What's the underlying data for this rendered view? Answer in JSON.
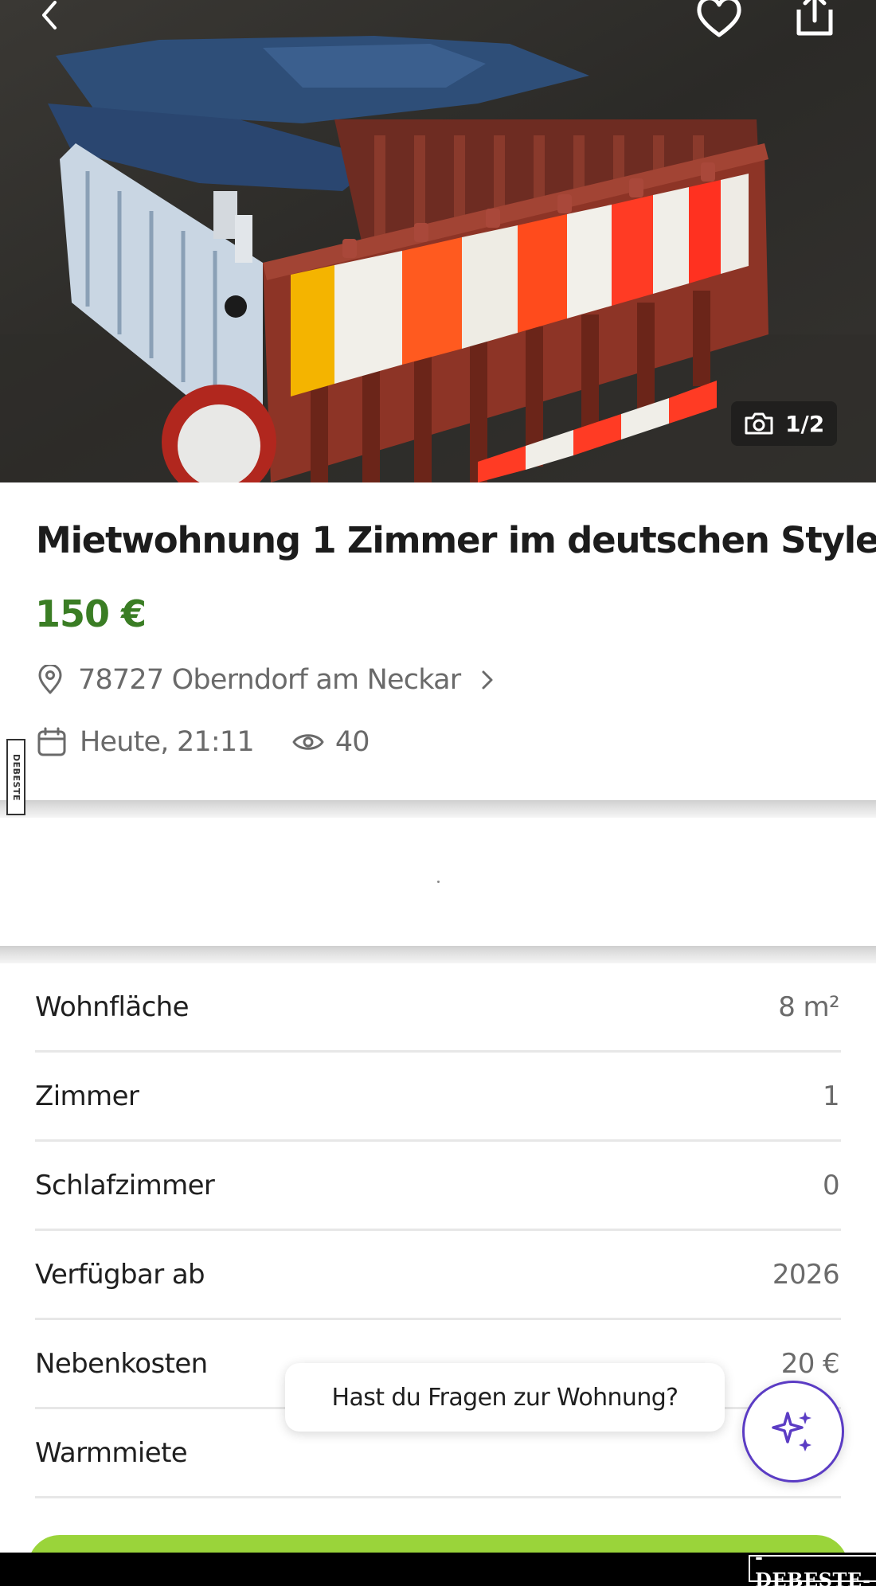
{
  "hero": {
    "photo_counter": "1/2",
    "icons": [
      "back-arrow-icon",
      "heart-icon",
      "share-icon",
      "camera-icon"
    ]
  },
  "listing": {
    "title": "Mietwohnung 1 Zimmer im deutschen Style",
    "price": "150 €",
    "location": "78727 Oberndorf am Neckar",
    "date": "Heute, 21:11",
    "views": "40"
  },
  "attributes": [
    {
      "label": "Wohnfläche",
      "value": "8 m²"
    },
    {
      "label": "Zimmer",
      "value": "1"
    },
    {
      "label": "Schlafzimmer",
      "value": "0"
    },
    {
      "label": "Verfügbar ab",
      "value": "2026"
    },
    {
      "label": "Nebenkosten",
      "value": "20 €"
    },
    {
      "label": "Warmmiete",
      "value": ""
    }
  ],
  "chat": {
    "prompt": "Hast du Fragen zur Wohnung?"
  },
  "watermark": {
    "text": "-DEBESTE-",
    "side_text": "DEBESTE"
  },
  "colors": {
    "price": "#3a7d24",
    "accent_purple": "#5b3cc4",
    "cta_green": "#9ad43a"
  }
}
